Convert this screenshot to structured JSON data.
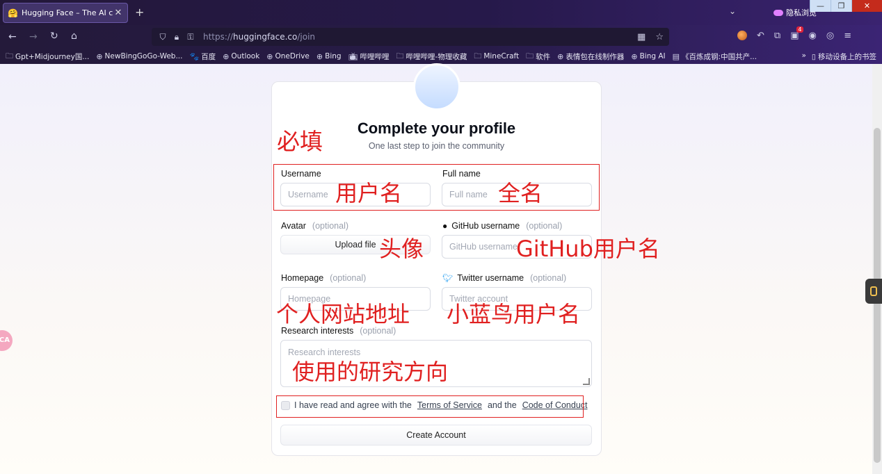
{
  "browser": {
    "tab_title": "Hugging Face – The AI comm",
    "tab_favicon": "🤗",
    "private_label": "隐私浏览",
    "url_prefix": "https://",
    "url_host": "huggingface.co",
    "url_path": "/join",
    "window_controls": [
      "—",
      "❐",
      "✕"
    ],
    "extension_badge_count": "4",
    "bookmarks": [
      {
        "icon": "folder-icon",
        "label": "Gpt+Midjourney国..."
      },
      {
        "icon": "globe-icon",
        "label": "NewBingGoGo-Web..."
      },
      {
        "icon": "baidu-icon",
        "label": "百度"
      },
      {
        "icon": "globe-icon",
        "label": "Outlook"
      },
      {
        "icon": "globe-icon",
        "label": "OneDrive"
      },
      {
        "icon": "globe-icon",
        "label": "Bing"
      },
      {
        "icon": "bilibili-icon",
        "label": "哔哩哔哩"
      },
      {
        "icon": "folder-icon",
        "label": "哔哩哔哩-物理收藏"
      },
      {
        "icon": "folder-icon",
        "label": "MineCraft"
      },
      {
        "icon": "folder-icon",
        "label": "软件"
      },
      {
        "icon": "globe-icon",
        "label": "表情包在线制作器"
      },
      {
        "icon": "globe-icon",
        "label": "Bing AI"
      },
      {
        "icon": "flag-icon",
        "label": "《百炼成钢:中国共产..."
      }
    ],
    "bookmarks_overflow": "»",
    "mobile_bookmarks": "移动设备上的书签"
  },
  "form": {
    "title": "Complete your profile",
    "subtitle": "One last step to join the community",
    "username": {
      "label": "Username",
      "placeholder": "Username"
    },
    "fullname": {
      "label": "Full name",
      "placeholder": "Full name"
    },
    "avatar": {
      "label": "Avatar",
      "optional": "(optional)",
      "button": "Upload file"
    },
    "github": {
      "label": "GitHub username",
      "optional": "(optional)",
      "placeholder": "GitHub username"
    },
    "homepage": {
      "label": "Homepage",
      "optional": "(optional)",
      "placeholder": "Homepage"
    },
    "twitter": {
      "label": "Twitter username",
      "optional": "(optional)",
      "placeholder": "Twitter account"
    },
    "research": {
      "label": "Research interests",
      "optional": "(optional)",
      "placeholder": "Research interests"
    },
    "agree": {
      "prefix": "I have read and agree with the",
      "tos": "Terms of Service",
      "and": "and the",
      "coc": "Code of Conduct"
    },
    "submit": "Create Account"
  },
  "annotations": {
    "required": "必填",
    "username": "用户名",
    "fullname": "全名",
    "avatar": "头像",
    "github": "GitHub用户名",
    "homepage": "个人网站地址",
    "twitter": "小蓝鸟用户名",
    "research": "使用的研究方向",
    "color": "#e02020"
  },
  "side_badge": "CA"
}
